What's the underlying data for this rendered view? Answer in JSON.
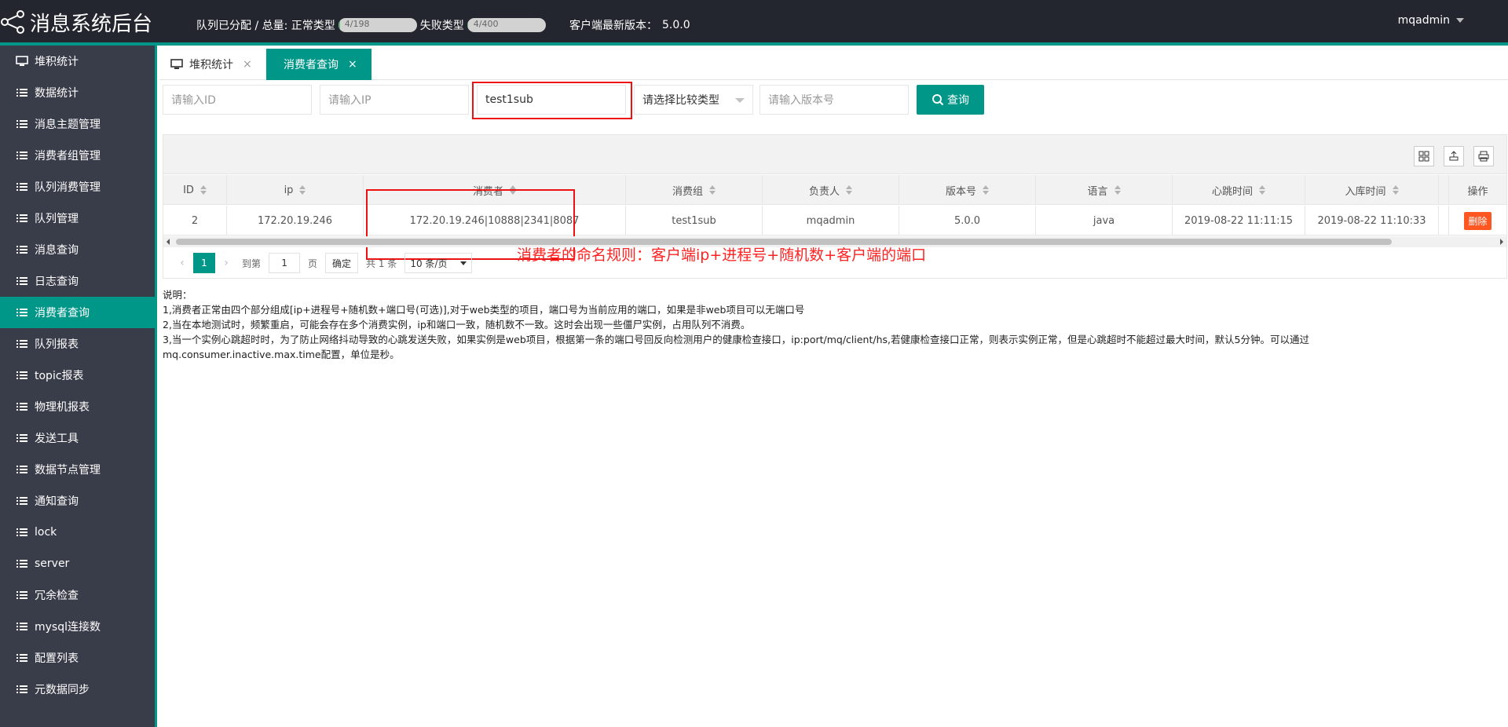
{
  "header": {
    "title": "消息系统后台",
    "queue_label": "队列已分配 / 总量: 正常类型",
    "normal_progress": "4/198",
    "normal_fraction": 0.02,
    "fail_label": "失败类型",
    "fail_progress": "4/400",
    "fail_fraction": 0.01,
    "version_label": "客户端最新版本：",
    "version": "5.0.0",
    "user": "mqadmin"
  },
  "sidebar": {
    "items": [
      {
        "label": "堆积统计",
        "icon": "monitor-icon"
      },
      {
        "label": "数据统计",
        "icon": "list-icon"
      },
      {
        "label": "消息主题管理",
        "icon": "list-icon"
      },
      {
        "label": "消费者组管理",
        "icon": "list-icon"
      },
      {
        "label": "队列消费管理",
        "icon": "list-icon"
      },
      {
        "label": "队列管理",
        "icon": "list-icon"
      },
      {
        "label": "消息查询",
        "icon": "list-icon"
      },
      {
        "label": "日志查询",
        "icon": "list-icon"
      },
      {
        "label": "消费者查询",
        "icon": "list-icon",
        "active": true
      },
      {
        "label": "队列报表",
        "icon": "list-icon"
      },
      {
        "label": "topic报表",
        "icon": "list-icon"
      },
      {
        "label": "物理机报表",
        "icon": "list-icon"
      },
      {
        "label": "发送工具",
        "icon": "list-icon"
      },
      {
        "label": "数据节点管理",
        "icon": "list-icon"
      },
      {
        "label": "通知查询",
        "icon": "list-icon"
      },
      {
        "label": "lock",
        "icon": "list-icon"
      },
      {
        "label": "server",
        "icon": "list-icon"
      },
      {
        "label": "冗余检查",
        "icon": "list-icon"
      },
      {
        "label": "mysql连接数",
        "icon": "list-icon"
      },
      {
        "label": "配置列表",
        "icon": "list-icon"
      },
      {
        "label": "元数据同步",
        "icon": "list-icon"
      }
    ]
  },
  "tabs": [
    {
      "label": "堆积统计",
      "close": "×"
    },
    {
      "label": "消费者查询",
      "close": "×"
    }
  ],
  "filters": {
    "id_placeholder": "请输入ID",
    "ip_placeholder": "请输入IP",
    "consumer_value": "test1sub",
    "compare_placeholder": "请选择比较类型",
    "version_placeholder": "请输入版本号",
    "search_label": "查询"
  },
  "table": {
    "columns": [
      "ID",
      "ip",
      "消费者",
      "消费组",
      "负责人",
      "版本号",
      "语言",
      "心跳时间",
      "入库时间",
      "操作"
    ],
    "rows": [
      {
        "id": "2",
        "ip": "172.20.19.246",
        "consumer": "172.20.19.246|10888|2341|8087",
        "group": "test1sub",
        "owner": "mqadmin",
        "version": "5.0.0",
        "language": "java",
        "heartbeat": "2019-08-22 11:11:15",
        "stored": "2019-08-22 11:10:33",
        "action": "删除"
      }
    ]
  },
  "pager": {
    "prev": "‹",
    "current": "1",
    "next": "›",
    "goto_label": "到第",
    "page_input": "1",
    "page_unit": "页",
    "confirm": "确定",
    "total": "共 1 条",
    "page_size": "10 条/页"
  },
  "annotation": "消费者的命名规则：客户端ip+进程号+随机数+客户端的端口",
  "notes": {
    "title": "说明：",
    "line1": "1,消费者正常由四个部分组成[ip+进程号+随机数+端口号(可选)],对于web类型的项目，端口号为当前应用的端口，如果是非web项目可以无端口号",
    "line2": "2,当在本地测试时，频繁重启，可能会存在多个消费实例，ip和端口一致，随机数不一致。这时会出现一些僵尸实例，占用队列不消费。",
    "line3": "3,当一个实例心跳超时时，为了防止网络抖动导致的心跳发送失败，如果实例是web项目，根据第一条的端口号回反向检测用户的健康检查接口，ip:port/mq/client/hs,若健康检查接口正常，则表示实例正常，但是心跳超时不能超过最大时间，默认5分钟。可以通过",
    "line4": "mq.consumer.inactive.max.time配置，单位是秒。"
  },
  "colors": {
    "accent": "#009688",
    "header_bg": "#23262e",
    "sidebar_bg": "#393d49",
    "danger": "#ff5722",
    "annotation": "#ff2222"
  }
}
